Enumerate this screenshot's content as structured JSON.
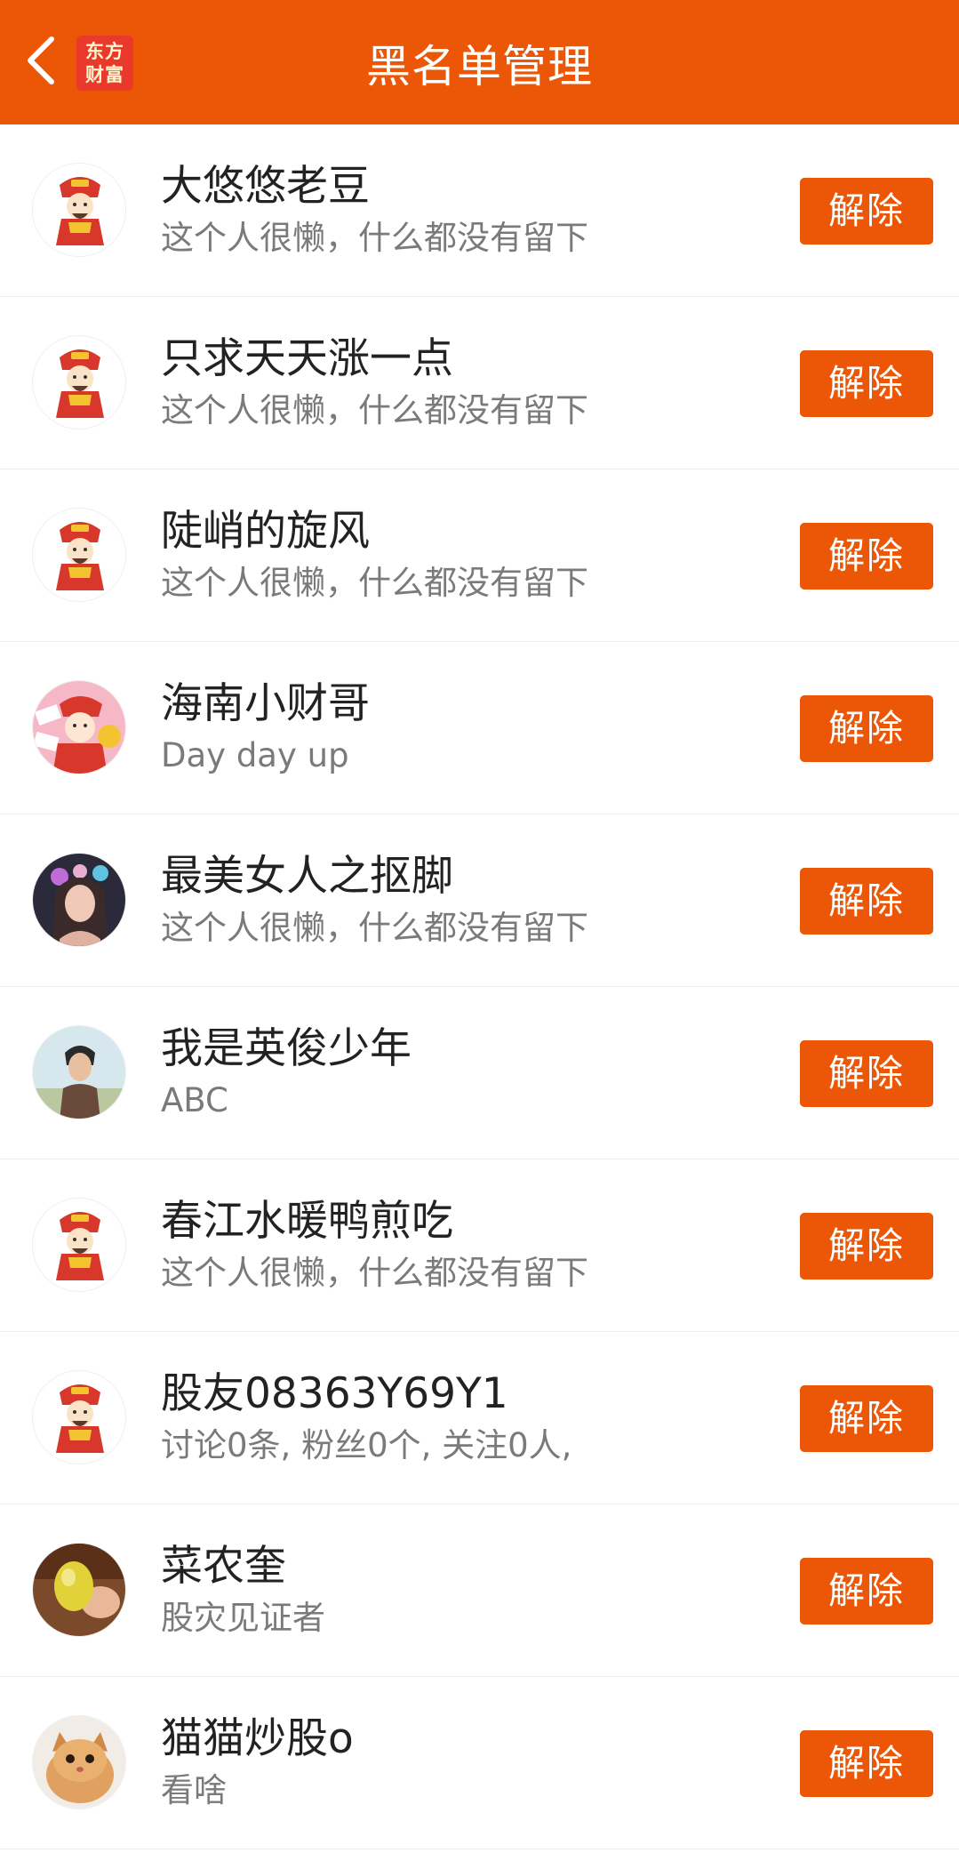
{
  "header": {
    "title": "黑名单管理",
    "back_icon": "chevron-left-icon",
    "logo_line1": "东方",
    "logo_line2": "财富",
    "background_color": "#eb5706"
  },
  "accent_color": "#eb5706",
  "blocked_users": [
    {
      "name": "大悠悠老豆",
      "bio": "这个人很懒，什么都没有留下",
      "avatar": "default-mascot-avatar",
      "button_label": "解除"
    },
    {
      "name": "只求天天涨一点",
      "bio": "这个人很懒，什么都没有留下",
      "avatar": "default-mascot-avatar",
      "button_label": "解除"
    },
    {
      "name": "陡峭的旋风",
      "bio": "这个人很懒，什么都没有留下",
      "avatar": "default-mascot-avatar",
      "button_label": "解除"
    },
    {
      "name": "海南小财哥",
      "bio": "Day day up",
      "avatar": "fortune-mascot-avatar",
      "button_label": "解除"
    },
    {
      "name": "最美女人之抠脚",
      "bio": "这个人很懒，什么都没有留下",
      "avatar": "portrait-photo-avatar",
      "button_label": "解除"
    },
    {
      "name": "我是英俊少年",
      "bio": "ABC",
      "avatar": "portrait-photo-avatar",
      "button_label": "解除"
    },
    {
      "name": "春江水暖鸭煎吃",
      "bio": "这个人很懒，什么都没有留下",
      "avatar": "default-mascot-avatar",
      "button_label": "解除"
    },
    {
      "name": "股友08363Y69Y1",
      "bio": "讨论0条, 粉丝0个, 关注0人,",
      "avatar": "default-mascot-avatar",
      "button_label": "解除"
    },
    {
      "name": "菜农奎",
      "bio": "股灾见证者",
      "avatar": "fruit-photo-avatar",
      "button_label": "解除"
    },
    {
      "name": "猫猫炒股o",
      "bio": "看啥",
      "avatar": "kitten-photo-avatar",
      "button_label": "解除"
    }
  ]
}
